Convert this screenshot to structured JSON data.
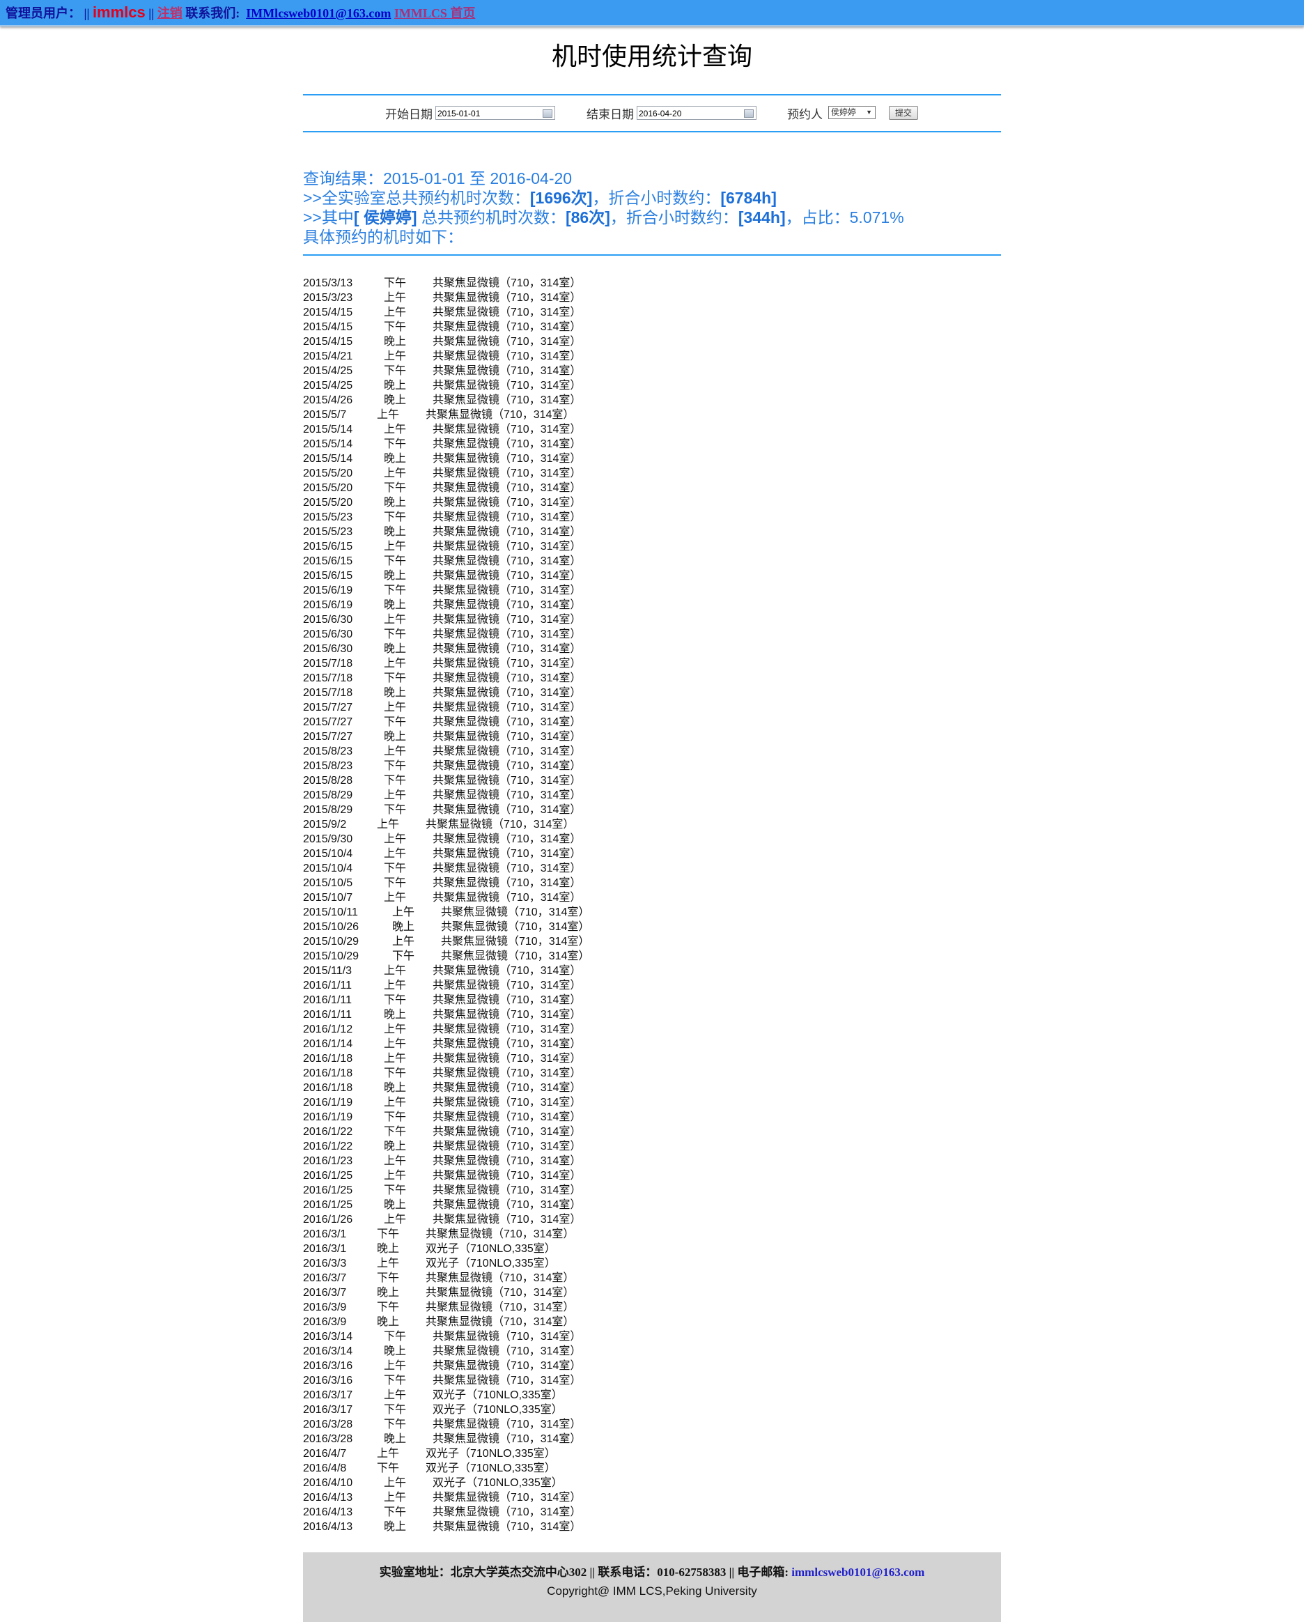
{
  "topbar": {
    "admin_label": "管理员用户：",
    "sep1": "||",
    "username": "immlcs",
    "sep2": "||",
    "logout": "注销",
    "contact_label": "联系我们:",
    "email": "IMMlcsweb0101@163.com",
    "home": "IMMLCS 首页"
  },
  "page_title": "机时使用统计查询",
  "form": {
    "start_label": "开始日期",
    "start_value": "2015-01-01",
    "end_label": "结束日期",
    "end_value": "2016-04-20",
    "booker_label": "预约人",
    "booker_value": "侯婷婷",
    "submit_label": "提交"
  },
  "summary": {
    "line1": "查询结果：2015-01-01 至 2016-04-20",
    "line2_prefix": ">>全实验室总共预约机时次数：",
    "line2_count": "[1696次]",
    "line2_mid": "，折合小时数约：",
    "line2_hours": "[6784h]",
    "line3_prefix": ">>其中",
    "line3_name": "[ 侯婷婷]",
    "line3_mid1": " 总共预约机时次数：",
    "line3_count": "[86次]",
    "line3_mid2": "，折合小时数约：",
    "line3_hours": "[344h]",
    "line3_ratio": "，占比：5.071%",
    "line4": "具体预约的机时如下："
  },
  "bookings": [
    [
      "2015/3/13",
      "下午",
      "共聚焦显微镜（710，314室）"
    ],
    [
      "2015/3/23",
      "上午",
      "共聚焦显微镜（710，314室）"
    ],
    [
      "2015/4/15",
      "上午",
      "共聚焦显微镜（710，314室）"
    ],
    [
      "2015/4/15",
      "下午",
      "共聚焦显微镜（710，314室）"
    ],
    [
      "2015/4/15",
      "晚上",
      "共聚焦显微镜（710，314室）"
    ],
    [
      "2015/4/21",
      "上午",
      "共聚焦显微镜（710，314室）"
    ],
    [
      "2015/4/25",
      "下午",
      "共聚焦显微镜（710，314室）"
    ],
    [
      "2015/4/25",
      "晚上",
      "共聚焦显微镜（710，314室）"
    ],
    [
      "2015/4/26",
      "晚上",
      "共聚焦显微镜（710，314室）"
    ],
    [
      "2015/5/7",
      "上午",
      "共聚焦显微镜（710，314室）"
    ],
    [
      "2015/5/14",
      "上午",
      "共聚焦显微镜（710，314室）"
    ],
    [
      "2015/5/14",
      "下午",
      "共聚焦显微镜（710，314室）"
    ],
    [
      "2015/5/14",
      "晚上",
      "共聚焦显微镜（710，314室）"
    ],
    [
      "2015/5/20",
      "上午",
      "共聚焦显微镜（710，314室）"
    ],
    [
      "2015/5/20",
      "下午",
      "共聚焦显微镜（710，314室）"
    ],
    [
      "2015/5/20",
      "晚上",
      "共聚焦显微镜（710，314室）"
    ],
    [
      "2015/5/23",
      "下午",
      "共聚焦显微镜（710，314室）"
    ],
    [
      "2015/5/23",
      "晚上",
      "共聚焦显微镜（710，314室）"
    ],
    [
      "2015/6/15",
      "上午",
      "共聚焦显微镜（710，314室）"
    ],
    [
      "2015/6/15",
      "下午",
      "共聚焦显微镜（710，314室）"
    ],
    [
      "2015/6/15",
      "晚上",
      "共聚焦显微镜（710，314室）"
    ],
    [
      "2015/6/19",
      "下午",
      "共聚焦显微镜（710，314室）"
    ],
    [
      "2015/6/19",
      "晚上",
      "共聚焦显微镜（710，314室）"
    ],
    [
      "2015/6/30",
      "上午",
      "共聚焦显微镜（710，314室）"
    ],
    [
      "2015/6/30",
      "下午",
      "共聚焦显微镜（710，314室）"
    ],
    [
      "2015/6/30",
      "晚上",
      "共聚焦显微镜（710，314室）"
    ],
    [
      "2015/7/18",
      "上午",
      "共聚焦显微镜（710，314室）"
    ],
    [
      "2015/7/18",
      "下午",
      "共聚焦显微镜（710，314室）"
    ],
    [
      "2015/7/18",
      "晚上",
      "共聚焦显微镜（710，314室）"
    ],
    [
      "2015/7/27",
      "上午",
      "共聚焦显微镜（710，314室）"
    ],
    [
      "2015/7/27",
      "下午",
      "共聚焦显微镜（710，314室）"
    ],
    [
      "2015/7/27",
      "晚上",
      "共聚焦显微镜（710，314室）"
    ],
    [
      "2015/8/23",
      "上午",
      "共聚焦显微镜（710，314室）"
    ],
    [
      "2015/8/23",
      "下午",
      "共聚焦显微镜（710，314室）"
    ],
    [
      "2015/8/28",
      "下午",
      "共聚焦显微镜（710，314室）"
    ],
    [
      "2015/8/29",
      "上午",
      "共聚焦显微镜（710，314室）"
    ],
    [
      "2015/8/29",
      "下午",
      "共聚焦显微镜（710，314室）"
    ],
    [
      "2015/9/2",
      "上午",
      "共聚焦显微镜（710，314室）"
    ],
    [
      "2015/9/30",
      "上午",
      "共聚焦显微镜（710，314室）"
    ],
    [
      "2015/10/4",
      "上午",
      "共聚焦显微镜（710，314室）"
    ],
    [
      "2015/10/4",
      "下午",
      "共聚焦显微镜（710，314室）"
    ],
    [
      "2015/10/5",
      "下午",
      "共聚焦显微镜（710，314室）"
    ],
    [
      "2015/10/7",
      "上午",
      "共聚焦显微镜（710，314室）"
    ],
    [
      "2015/10/11",
      "上午",
      "共聚焦显微镜（710，314室）"
    ],
    [
      "2015/10/26",
      "晚上",
      "共聚焦显微镜（710，314室）"
    ],
    [
      "2015/10/29",
      "上午",
      "共聚焦显微镜（710，314室）"
    ],
    [
      "2015/10/29",
      "下午",
      "共聚焦显微镜（710，314室）"
    ],
    [
      "2015/11/3",
      "上午",
      "共聚焦显微镜（710，314室）"
    ],
    [
      "2016/1/11",
      "上午",
      "共聚焦显微镜（710，314室）"
    ],
    [
      "2016/1/11",
      "下午",
      "共聚焦显微镜（710，314室）"
    ],
    [
      "2016/1/11",
      "晚上",
      "共聚焦显微镜（710，314室）"
    ],
    [
      "2016/1/12",
      "上午",
      "共聚焦显微镜（710，314室）"
    ],
    [
      "2016/1/14",
      "上午",
      "共聚焦显微镜（710，314室）"
    ],
    [
      "2016/1/18",
      "上午",
      "共聚焦显微镜（710，314室）"
    ],
    [
      "2016/1/18",
      "下午",
      "共聚焦显微镜（710，314室）"
    ],
    [
      "2016/1/18",
      "晚上",
      "共聚焦显微镜（710，314室）"
    ],
    [
      "2016/1/19",
      "上午",
      "共聚焦显微镜（710，314室）"
    ],
    [
      "2016/1/19",
      "下午",
      "共聚焦显微镜（710，314室）"
    ],
    [
      "2016/1/22",
      "下午",
      "共聚焦显微镜（710，314室）"
    ],
    [
      "2016/1/22",
      "晚上",
      "共聚焦显微镜（710，314室）"
    ],
    [
      "2016/1/23",
      "上午",
      "共聚焦显微镜（710，314室）"
    ],
    [
      "2016/1/25",
      "上午",
      "共聚焦显微镜（710，314室）"
    ],
    [
      "2016/1/25",
      "下午",
      "共聚焦显微镜（710，314室）"
    ],
    [
      "2016/1/25",
      "晚上",
      "共聚焦显微镜（710，314室）"
    ],
    [
      "2016/1/26",
      "上午",
      "共聚焦显微镜（710，314室）"
    ],
    [
      "2016/3/1",
      "下午",
      "共聚焦显微镜（710，314室）"
    ],
    [
      "2016/3/1",
      "晚上",
      "双光子（710NLO,335室）"
    ],
    [
      "2016/3/3",
      "上午",
      "双光子（710NLO,335室）"
    ],
    [
      "2016/3/7",
      "下午",
      "共聚焦显微镜（710，314室）"
    ],
    [
      "2016/3/7",
      "晚上",
      "共聚焦显微镜（710，314室）"
    ],
    [
      "2016/3/9",
      "下午",
      "共聚焦显微镜（710，314室）"
    ],
    [
      "2016/3/9",
      "晚上",
      "共聚焦显微镜（710，314室）"
    ],
    [
      "2016/3/14",
      "下午",
      "共聚焦显微镜（710，314室）"
    ],
    [
      "2016/3/14",
      "晚上",
      "共聚焦显微镜（710，314室）"
    ],
    [
      "2016/3/16",
      "上午",
      "共聚焦显微镜（710，314室）"
    ],
    [
      "2016/3/16",
      "下午",
      "共聚焦显微镜（710，314室）"
    ],
    [
      "2016/3/17",
      "上午",
      "双光子（710NLO,335室）"
    ],
    [
      "2016/3/17",
      "下午",
      "双光子（710NLO,335室）"
    ],
    [
      "2016/3/28",
      "下午",
      "共聚焦显微镜（710，314室）"
    ],
    [
      "2016/3/28",
      "晚上",
      "共聚焦显微镜（710，314室）"
    ],
    [
      "2016/4/7",
      "上午",
      "双光子（710NLO,335室）"
    ],
    [
      "2016/4/8",
      "下午",
      "双光子（710NLO,335室）"
    ],
    [
      "2016/4/10",
      "上午",
      "双光子（710NLO,335室）"
    ],
    [
      "2016/4/13",
      "上午",
      "共聚焦显微镜（710，314室）"
    ],
    [
      "2016/4/13",
      "下午",
      "共聚焦显微镜（710，314室）"
    ],
    [
      "2016/4/13",
      "晚上",
      "共聚焦显微镜（710，314室）"
    ]
  ],
  "footer": {
    "address_label": "实验室地址：北京大学英杰交流中心302 ||",
    "phone_label": " 联系电话：010-62758383 ||",
    "email_label": " 电子邮箱: ",
    "email": "immlcsweb0101@163.com",
    "copyright": "Copyright@ IMM LCS,Peking University"
  }
}
